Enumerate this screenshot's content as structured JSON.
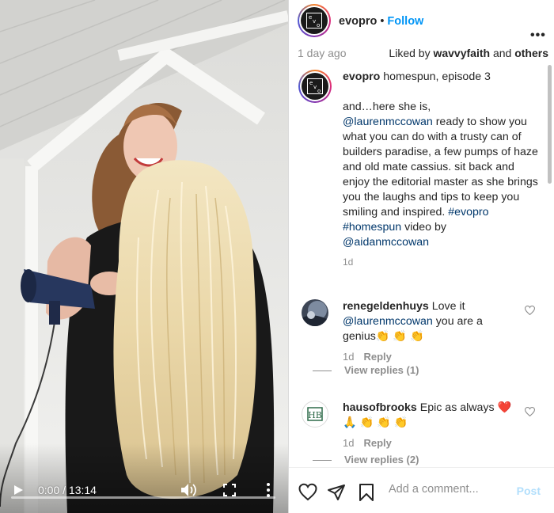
{
  "video": {
    "time": "0:00 / 13:14",
    "progress": 0
  },
  "post": {
    "username": "evopro",
    "follow": "Follow",
    "separator": "•",
    "age": "1 day ago",
    "liked_prefix": "Liked by ",
    "liked_user": "wavvyfaith",
    "liked_and": " and ",
    "liked_others": "others"
  },
  "caption": {
    "username": "evopro",
    "title": "homespun, episode 3",
    "text_1": "and…here she is,",
    "mention_1": "@laurenmccowan",
    "text_2": " ready to show you what you can do with a trusty can of builders paradise, a few pumps of haze and old mate cassius. sit back and enjoy the editorial master as she brings you the laughs and tips to keep you smiling and inspired. ",
    "tag_1": "#evopro",
    "tag_2": "#homespun",
    "text_3": " video by ",
    "mention_2": "@aidanmccowan",
    "age": "1d"
  },
  "comments": [
    {
      "username": "renegeldenhuys",
      "text_1": "Love it",
      "mention": "@laurenmccowan",
      "text_2": " you are a genius👏 👏 👏",
      "age": "1d",
      "reply": "Reply",
      "view_replies": "View replies (1)"
    },
    {
      "username": "hausofbrooks",
      "text_1": "Epic as always ❤️ 🙏 👏 👏 👏",
      "age": "1d",
      "reply": "Reply",
      "view_replies": "View replies (2)"
    }
  ],
  "footer": {
    "placeholder": "Add a comment...",
    "post": "Post"
  },
  "colors": {
    "accent": "#0095f6",
    "link": "#00376b",
    "muted": "#8e8e8e",
    "post_disabled": "#b2dffc"
  }
}
